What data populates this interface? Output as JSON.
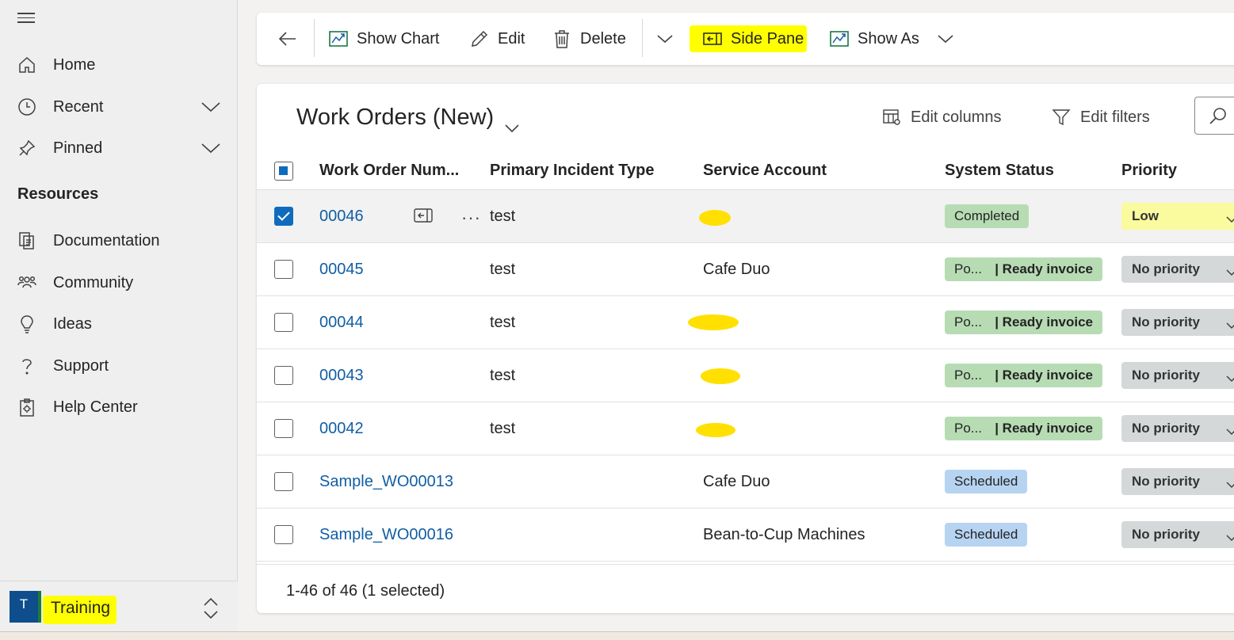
{
  "sidebar": {
    "nav": [
      {
        "label": "Home",
        "icon": "home-icon"
      },
      {
        "label": "Recent",
        "icon": "clock-icon",
        "expandable": true
      },
      {
        "label": "Pinned",
        "icon": "pin-icon",
        "expandable": true
      }
    ],
    "section_title": "Resources",
    "resources": [
      {
        "label": "Documentation",
        "icon": "documents-icon"
      },
      {
        "label": "Community",
        "icon": "people-icon"
      },
      {
        "label": "Ideas",
        "icon": "lightbulb-icon"
      },
      {
        "label": "Support",
        "icon": "question-icon"
      },
      {
        "label": "Help Center",
        "icon": "clipboard-gear-icon"
      }
    ],
    "area": {
      "avatar_letter": "T",
      "label": "Training"
    }
  },
  "commandbar": {
    "show_chart": "Show Chart",
    "edit": "Edit",
    "delete": "Delete",
    "side_pane": "Side Pane",
    "show_as": "Show As"
  },
  "view": {
    "title": "Work Orders (New)",
    "edit_columns": "Edit columns",
    "edit_filters": "Edit filters"
  },
  "columns": [
    "Work Order Num...",
    "Primary Incident Type",
    "Service Account",
    "System Status",
    "Priority"
  ],
  "rows": [
    {
      "number": "00046",
      "incident": "test",
      "account": "",
      "status_type": "green-single",
      "status": "Completed",
      "status_sub": "",
      "priority": "Low",
      "selected": true
    },
    {
      "number": "00045",
      "incident": "test",
      "account": "Cafe Duo",
      "status_type": "split",
      "status": "Po...",
      "status_sub": "| Ready invoice",
      "priority": "No priority",
      "selected": false
    },
    {
      "number": "00044",
      "incident": "test",
      "account": "",
      "status_type": "split",
      "status": "Po...",
      "status_sub": "| Ready invoice",
      "priority": "No priority",
      "selected": false
    },
    {
      "number": "00043",
      "incident": "test",
      "account": "",
      "status_type": "split",
      "status": "Po...",
      "status_sub": "| Ready invoice",
      "priority": "No priority",
      "selected": false
    },
    {
      "number": "00042",
      "incident": "test",
      "account": "",
      "status_type": "split",
      "status": "Po...",
      "status_sub": "| Ready invoice",
      "priority": "No priority",
      "selected": false
    },
    {
      "number": "Sample_WO00013",
      "incident": "",
      "account": "Cafe Duo",
      "status_type": "blue",
      "status": "Scheduled",
      "status_sub": "",
      "priority": "No priority",
      "selected": false
    },
    {
      "number": "Sample_WO00016",
      "incident": "",
      "account": "Bean-to-Cup Machines",
      "status_type": "blue",
      "status": "Scheduled",
      "status_sub": "",
      "priority": "No priority",
      "selected": false
    }
  ],
  "footer": {
    "record_count": "1-46 of 46 (1 selected)"
  },
  "colors": {
    "highlight": "#ffff00",
    "link": "#115ea3",
    "accent": "#0f6cbd",
    "status_green": "#b7dcb4",
    "status_blue": "#b6d4f2",
    "priority_low": "#fafa9e",
    "priority_none": "#d5d8d8"
  }
}
